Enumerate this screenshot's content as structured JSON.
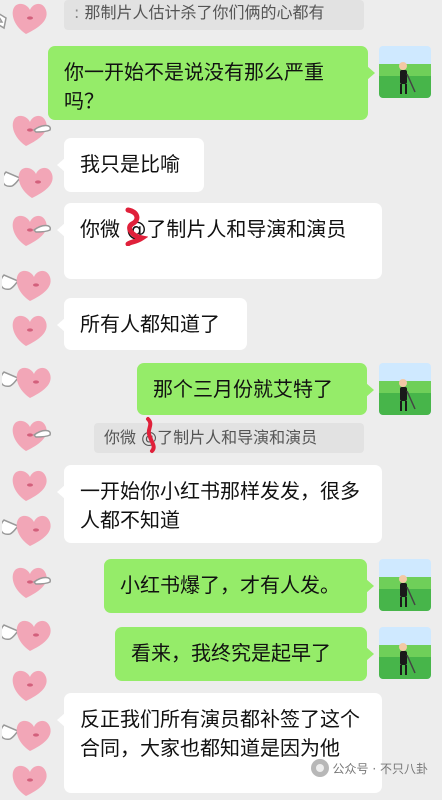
{
  "chat": {
    "top_quote": "那制片人估计杀了你们俩的心都有",
    "messages": [
      {
        "side": "right",
        "text": "你一开始不是说没有那么严重吗？"
      },
      {
        "side": "left",
        "text": "我只是比喻"
      },
      {
        "side": "left",
        "text": "你微 @了制片人和导演和演员"
      },
      {
        "side": "left",
        "text": "所有人都知道了"
      },
      {
        "side": "right",
        "text": "那个三月份就艾特了"
      },
      {
        "side": "left",
        "text": "一开始你小红书那样发发，很多人都不知道"
      },
      {
        "side": "right",
        "text": "小红书爆了，才有人发。"
      },
      {
        "side": "right",
        "text": "看来，我终究是起早了"
      },
      {
        "side": "left",
        "text": "反正我们所有演员都补签了这个合同，大家也都知道是因为他"
      }
    ],
    "quote_reply": "你微 @了制片人和导演和演员"
  },
  "watermark": "公众号 · 不只八卦",
  "icons": {
    "left_avatar": "winged-heart-icon",
    "right_avatar": "golf-player-avatar",
    "redaction": "red-scribble-mark",
    "watermark_icon": "wechat-official-account-icon"
  },
  "colors": {
    "background": "#ededed",
    "sent_bubble": "#95ec69",
    "received_bubble": "#ffffff",
    "quote_box": "#e2e2e2",
    "heart": "#f2a6b7",
    "redaction": "#e0203a"
  }
}
